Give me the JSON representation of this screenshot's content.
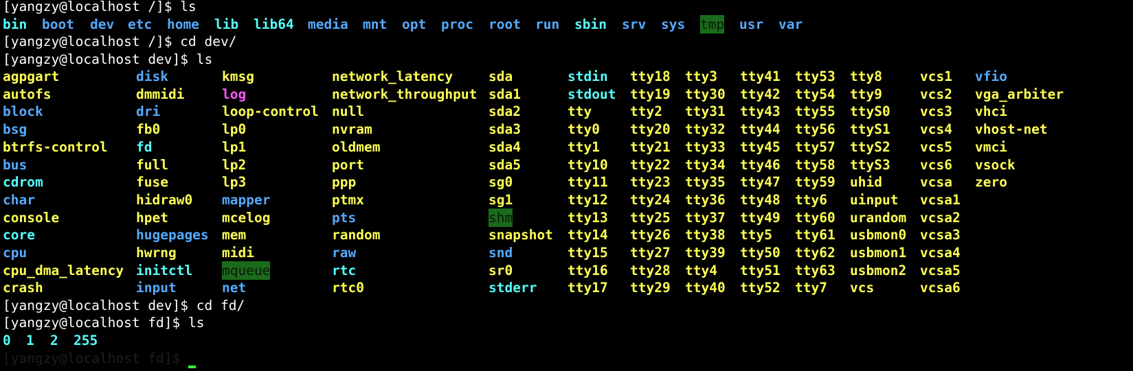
{
  "prompt": {
    "root": "[yangzy@localhost /]$ ",
    "dev": "[yangzy@localhost dev]$ ",
    "fd": "[yangzy@localhost fd]$ "
  },
  "commands": {
    "ls": "ls",
    "cd_dev": "cd dev/",
    "cd_fd": "cd fd/"
  },
  "colors": {
    "directory": "#55aaff",
    "link": "#55ffff",
    "device": "#ffff55",
    "symlink_special": "#ff55ff",
    "sticky_dir_bg": "#1a6b1a",
    "cursor": "#33ff33"
  },
  "root_listing": [
    {
      "name": "bin",
      "type": "link"
    },
    {
      "name": "boot",
      "type": "directory"
    },
    {
      "name": "dev",
      "type": "directory"
    },
    {
      "name": "etc",
      "type": "directory"
    },
    {
      "name": "home",
      "type": "directory"
    },
    {
      "name": "lib",
      "type": "link"
    },
    {
      "name": "lib64",
      "type": "link"
    },
    {
      "name": "media",
      "type": "directory"
    },
    {
      "name": "mnt",
      "type": "directory"
    },
    {
      "name": "opt",
      "type": "directory"
    },
    {
      "name": "proc",
      "type": "directory"
    },
    {
      "name": "root",
      "type": "directory"
    },
    {
      "name": "run",
      "type": "directory"
    },
    {
      "name": "sbin",
      "type": "link"
    },
    {
      "name": "srv",
      "type": "directory"
    },
    {
      "name": "sys",
      "type": "directory"
    },
    {
      "name": "tmp",
      "type": "sticky"
    },
    {
      "name": "usr",
      "type": "directory"
    },
    {
      "name": "var",
      "type": "directory"
    }
  ],
  "dev_listing": [
    [
      [
        "agpgart",
        "y"
      ],
      [
        "disk",
        "b"
      ],
      [
        "kmsg",
        "y"
      ],
      [
        "network_latency",
        "y"
      ],
      [
        "sda",
        "y"
      ],
      [
        "stdin",
        "c"
      ],
      [
        "tty18",
        "y"
      ],
      [
        "tty3",
        "y"
      ],
      [
        "tty41",
        "y"
      ],
      [
        "tty53",
        "y"
      ],
      [
        "tty8",
        "y"
      ],
      [
        "vcs1",
        "y"
      ],
      [
        "vfio",
        "b"
      ]
    ],
    [
      [
        "autofs",
        "y"
      ],
      [
        "dmmidi",
        "y"
      ],
      [
        "log",
        "m"
      ],
      [
        "network_throughput",
        "y"
      ],
      [
        "sda1",
        "y"
      ],
      [
        "stdout",
        "c"
      ],
      [
        "tty19",
        "y"
      ],
      [
        "tty30",
        "y"
      ],
      [
        "tty42",
        "y"
      ],
      [
        "tty54",
        "y"
      ],
      [
        "tty9",
        "y"
      ],
      [
        "vcs2",
        "y"
      ],
      [
        "vga_arbiter",
        "y"
      ]
    ],
    [
      [
        "block",
        "b"
      ],
      [
        "dri",
        "b"
      ],
      [
        "loop-control",
        "y"
      ],
      [
        "null",
        "y"
      ],
      [
        "sda2",
        "y"
      ],
      [
        "tty",
        "y"
      ],
      [
        "tty2",
        "y"
      ],
      [
        "tty31",
        "y"
      ],
      [
        "tty43",
        "y"
      ],
      [
        "tty55",
        "y"
      ],
      [
        "ttyS0",
        "y"
      ],
      [
        "vcs3",
        "y"
      ],
      [
        "vhci",
        "y"
      ]
    ],
    [
      [
        "bsg",
        "b"
      ],
      [
        "fb0",
        "y"
      ],
      [
        "lp0",
        "y"
      ],
      [
        "nvram",
        "y"
      ],
      [
        "sda3",
        "y"
      ],
      [
        "tty0",
        "y"
      ],
      [
        "tty20",
        "y"
      ],
      [
        "tty32",
        "y"
      ],
      [
        "tty44",
        "y"
      ],
      [
        "tty56",
        "y"
      ],
      [
        "ttyS1",
        "y"
      ],
      [
        "vcs4",
        "y"
      ],
      [
        "vhost-net",
        "y"
      ]
    ],
    [
      [
        "btrfs-control",
        "y"
      ],
      [
        "fd",
        "c"
      ],
      [
        "lp1",
        "y"
      ],
      [
        "oldmem",
        "y"
      ],
      [
        "sda4",
        "y"
      ],
      [
        "tty1",
        "y"
      ],
      [
        "tty21",
        "y"
      ],
      [
        "tty33",
        "y"
      ],
      [
        "tty45",
        "y"
      ],
      [
        "tty57",
        "y"
      ],
      [
        "ttyS2",
        "y"
      ],
      [
        "vcs5",
        "y"
      ],
      [
        "vmci",
        "y"
      ]
    ],
    [
      [
        "bus",
        "b"
      ],
      [
        "full",
        "y"
      ],
      [
        "lp2",
        "y"
      ],
      [
        "port",
        "y"
      ],
      [
        "sda5",
        "y"
      ],
      [
        "tty10",
        "y"
      ],
      [
        "tty22",
        "y"
      ],
      [
        "tty34",
        "y"
      ],
      [
        "tty46",
        "y"
      ],
      [
        "tty58",
        "y"
      ],
      [
        "ttyS3",
        "y"
      ],
      [
        "vcs6",
        "y"
      ],
      [
        "vsock",
        "y"
      ]
    ],
    [
      [
        "cdrom",
        "c"
      ],
      [
        "fuse",
        "y"
      ],
      [
        "lp3",
        "y"
      ],
      [
        "ppp",
        "y"
      ],
      [
        "sg0",
        "y"
      ],
      [
        "tty11",
        "y"
      ],
      [
        "tty23",
        "y"
      ],
      [
        "tty35",
        "y"
      ],
      [
        "tty47",
        "y"
      ],
      [
        "tty59",
        "y"
      ],
      [
        "uhid",
        "y"
      ],
      [
        "vcsa",
        "y"
      ],
      [
        "zero",
        "y"
      ]
    ],
    [
      [
        "char",
        "b"
      ],
      [
        "hidraw0",
        "y"
      ],
      [
        "mapper",
        "b"
      ],
      [
        "ptmx",
        "y"
      ],
      [
        "sg1",
        "y"
      ],
      [
        "tty12",
        "y"
      ],
      [
        "tty24",
        "y"
      ],
      [
        "tty36",
        "y"
      ],
      [
        "tty48",
        "y"
      ],
      [
        "tty6",
        "y"
      ],
      [
        "uinput",
        "y"
      ],
      [
        "vcsa1",
        "y"
      ]
    ],
    [
      [
        "console",
        "y"
      ],
      [
        "hpet",
        "y"
      ],
      [
        "mcelog",
        "y"
      ],
      [
        "pts",
        "b"
      ],
      [
        "shm",
        "g"
      ],
      [
        "tty13",
        "y"
      ],
      [
        "tty25",
        "y"
      ],
      [
        "tty37",
        "y"
      ],
      [
        "tty49",
        "y"
      ],
      [
        "tty60",
        "y"
      ],
      [
        "urandom",
        "y"
      ],
      [
        "vcsa2",
        "y"
      ]
    ],
    [
      [
        "core",
        "c"
      ],
      [
        "hugepages",
        "b"
      ],
      [
        "mem",
        "y"
      ],
      [
        "random",
        "y"
      ],
      [
        "snapshot",
        "y"
      ],
      [
        "tty14",
        "y"
      ],
      [
        "tty26",
        "y"
      ],
      [
        "tty38",
        "y"
      ],
      [
        "tty5",
        "y"
      ],
      [
        "tty61",
        "y"
      ],
      [
        "usbmon0",
        "y"
      ],
      [
        "vcsa3",
        "y"
      ]
    ],
    [
      [
        "cpu",
        "b"
      ],
      [
        "hwrng",
        "y"
      ],
      [
        "midi",
        "y"
      ],
      [
        "raw",
        "b"
      ],
      [
        "snd",
        "b"
      ],
      [
        "tty15",
        "y"
      ],
      [
        "tty27",
        "y"
      ],
      [
        "tty39",
        "y"
      ],
      [
        "tty50",
        "y"
      ],
      [
        "tty62",
        "y"
      ],
      [
        "usbmon1",
        "y"
      ],
      [
        "vcsa4",
        "y"
      ]
    ],
    [
      [
        "cpu_dma_latency",
        "y"
      ],
      [
        "initctl",
        "c"
      ],
      [
        "mqueue",
        "g"
      ],
      [
        "rtc",
        "c"
      ],
      [
        "sr0",
        "y"
      ],
      [
        "tty16",
        "y"
      ],
      [
        "tty28",
        "y"
      ],
      [
        "tty4",
        "y"
      ],
      [
        "tty51",
        "y"
      ],
      [
        "tty63",
        "y"
      ],
      [
        "usbmon2",
        "y"
      ],
      [
        "vcsa5",
        "y"
      ]
    ],
    [
      [
        "crash",
        "y"
      ],
      [
        "input",
        "b"
      ],
      [
        "net",
        "b"
      ],
      [
        "rtc0",
        "y"
      ],
      [
        "stderr",
        "c"
      ],
      [
        "tty17",
        "y"
      ],
      [
        "tty29",
        "y"
      ],
      [
        "tty40",
        "y"
      ],
      [
        "tty52",
        "y"
      ],
      [
        "tty7",
        "y"
      ],
      [
        "vcs",
        "y"
      ],
      [
        "vcsa6",
        "y"
      ]
    ]
  ],
  "fd_listing": [
    "0",
    "1",
    "2",
    "255"
  ],
  "partial_prompt": "[yangzy@localhost fd]$ "
}
